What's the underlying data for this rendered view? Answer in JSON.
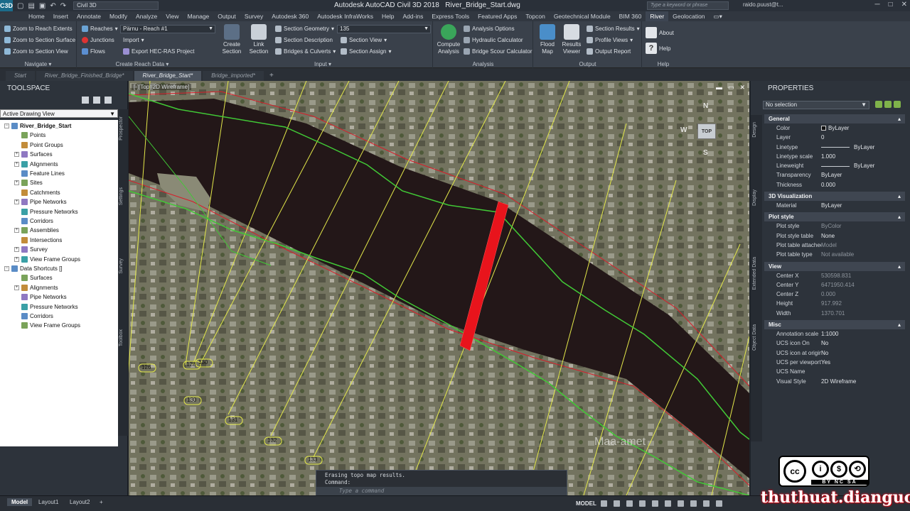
{
  "titlebar": {
    "app_logo": "C3D",
    "workspace": "Civil 3D",
    "app_title": "Autodesk AutoCAD Civil 3D 2018",
    "file_title": "River_Bridge_Start.dwg",
    "search_placeholder": "Type a keyword or phrase",
    "user": "raido.puust@t...",
    "icons": [
      "new-icon",
      "open-icon",
      "save-icon",
      "undo-icon",
      "redo-icon",
      "minimize-icon",
      "maximize-icon",
      "close-icon"
    ]
  },
  "menu_tabs": [
    "Home",
    "Insert",
    "Annotate",
    "Modify",
    "Analyze",
    "View",
    "Manage",
    "Output",
    "Survey",
    "Autodesk 360",
    "Autodesk InfraWorks",
    "Help",
    "Add-ins",
    "Express Tools",
    "Featured Apps",
    "Topcon",
    "Geotechnical Module",
    "BIM 360",
    "River",
    "Geolocation"
  ],
  "active_menu_tab": "River",
  "ribbon": {
    "navigate": {
      "label": "Navigate",
      "items": [
        "Zoom to Reach Extents",
        "Zoom to Section Surface",
        "Zoom to Section View"
      ]
    },
    "input": {
      "label": "Input",
      "reaches_label": "Reaches",
      "reaches_value": "Pärnu - Reach #1",
      "junctions": "Junctions",
      "flows": "Flows",
      "import": "Import",
      "export": "Export HEC-RAS Project",
      "create_section": "Create Section",
      "link_section": "Link Section",
      "section_geometry": "Section Geometry",
      "section_geometry_value": "135",
      "section_description": "Section Description",
      "bridges_culverts": "Bridges & Culverts",
      "section_view": "Section View",
      "section_assign": "Section Assign"
    },
    "create_reach_data": "Create Reach Data",
    "analysis": {
      "label": "Analysis",
      "compute": "Compute Analysis",
      "options": "Analysis Options",
      "hydraulic": "Hydraulic Calculator",
      "scour": "Bridge Scour Calculator"
    },
    "output": {
      "label": "Output",
      "flood_map": "Flood Map",
      "results_viewer": "Results Viewer",
      "section_results": "Section Results",
      "profile_views": "Profile Views",
      "output_report": "Output Report"
    },
    "help": {
      "label": "Help",
      "about": "About",
      "help": "Help"
    }
  },
  "doc_tabs": [
    "Start",
    "River_Bridge_Finished_Bridge*",
    "River_Bridge_Start*",
    "Bridge_imported*"
  ],
  "active_doc_tab": "River_Bridge_Start*",
  "toolspace": {
    "title": "TOOLSPACE",
    "view_select": "Active Drawing View",
    "vertical_tabs": [
      "Prospector",
      "Settings",
      "Survey",
      "Toolbox"
    ],
    "tree": [
      {
        "label": "River_Bridge_Start",
        "level": 0,
        "exp": "−",
        "bold": true
      },
      {
        "label": "Points",
        "level": 1,
        "exp": ""
      },
      {
        "label": "Point Groups",
        "level": 1,
        "exp": ""
      },
      {
        "label": "Surfaces",
        "level": 1,
        "exp": "+"
      },
      {
        "label": "Alignments",
        "level": 1,
        "exp": "+"
      },
      {
        "label": "Feature Lines",
        "level": 1,
        "exp": ""
      },
      {
        "label": "Sites",
        "level": 1,
        "exp": "+"
      },
      {
        "label": "Catchments",
        "level": 1,
        "exp": ""
      },
      {
        "label": "Pipe Networks",
        "level": 1,
        "exp": "+"
      },
      {
        "label": "Pressure Networks",
        "level": 1,
        "exp": ""
      },
      {
        "label": "Corridors",
        "level": 1,
        "exp": ""
      },
      {
        "label": "Assemblies",
        "level": 1,
        "exp": "+"
      },
      {
        "label": "Intersections",
        "level": 1,
        "exp": ""
      },
      {
        "label": "Survey",
        "level": 1,
        "exp": "+"
      },
      {
        "label": "View Frame Groups",
        "level": 1,
        "exp": "+"
      },
      {
        "label": "Data Shortcuts []",
        "level": 0,
        "exp": "−"
      },
      {
        "label": "Surfaces",
        "level": 1,
        "exp": ""
      },
      {
        "label": "Alignments",
        "level": 1,
        "exp": "+"
      },
      {
        "label": "Pipe Networks",
        "level": 1,
        "exp": ""
      },
      {
        "label": "Pressure Networks",
        "level": 1,
        "exp": ""
      },
      {
        "label": "Corridors",
        "level": 1,
        "exp": ""
      },
      {
        "label": "View Frame Groups",
        "level": 1,
        "exp": ""
      }
    ]
  },
  "viewport": {
    "label": "[-][Top][2D Wireframe]",
    "viewcube": {
      "top": "TOP",
      "n": "N",
      "s": "S",
      "w": "W"
    },
    "station_labels": [
      "126",
      "128",
      "130",
      "130",
      "131",
      "132",
      "133"
    ],
    "map_watermark": "Maa-amet",
    "colors": {
      "river": "#231718",
      "sections": "#e3e84a",
      "bank_lines": "#41c936",
      "bridge": "#e8141c"
    }
  },
  "command_line": {
    "line1": "Erasing topo map results.",
    "line2": "Command:",
    "placeholder": "Type a command"
  },
  "properties": {
    "title": "PROPERTIES",
    "selection": "No selection",
    "vertical_tabs": [
      "Design",
      "Display",
      "Extended Data",
      "Object Data"
    ],
    "sections": [
      {
        "name": "General",
        "rows": [
          {
            "k": "Color",
            "v": "ByLayer",
            "sw": true
          },
          {
            "k": "Layer",
            "v": "0"
          },
          {
            "k": "Linetype",
            "v": "ByLayer",
            "line": true
          },
          {
            "k": "Linetype scale",
            "v": "1.000"
          },
          {
            "k": "Lineweight",
            "v": "ByLayer",
            "line": true
          },
          {
            "k": "Transparency",
            "v": "ByLayer"
          },
          {
            "k": "Thickness",
            "v": "0.000"
          }
        ]
      },
      {
        "name": "3D Visualization",
        "rows": [
          {
            "k": "Material",
            "v": "ByLayer"
          }
        ]
      },
      {
        "name": "Plot style",
        "rows": [
          {
            "k": "Plot style",
            "v": "ByColor",
            "dim": true
          },
          {
            "k": "Plot style table",
            "v": "None"
          },
          {
            "k": "Plot table attached...",
            "v": "Model",
            "dim": true
          },
          {
            "k": "Plot table type",
            "v": "Not available",
            "dim": true
          }
        ]
      },
      {
        "name": "View",
        "rows": [
          {
            "k": "Center X",
            "v": "530598.831",
            "dim": true
          },
          {
            "k": "Center Y",
            "v": "6471950.414",
            "dim": true
          },
          {
            "k": "Center Z",
            "v": "0.000",
            "dim": true
          },
          {
            "k": "Height",
            "v": "917.992",
            "dim": true
          },
          {
            "k": "Width",
            "v": "1370.701",
            "dim": true
          }
        ]
      },
      {
        "name": "Misc",
        "rows": [
          {
            "k": "Annotation scale",
            "v": "1:1000"
          },
          {
            "k": "UCS icon On",
            "v": "No"
          },
          {
            "k": "UCS icon at origin",
            "v": "No"
          },
          {
            "k": "UCS per viewport",
            "v": "Yes"
          },
          {
            "k": "UCS Name",
            "v": ""
          },
          {
            "k": "Visual Style",
            "v": "2D Wireframe"
          }
        ]
      }
    ]
  },
  "statusbar": {
    "layout_tabs": [
      "Model",
      "Layout1",
      "Layout2"
    ],
    "model_label": "MODEL"
  },
  "license_badge": {
    "text": "BY  NC  SA"
  },
  "watermark": "thuthuat.dianguc.info"
}
